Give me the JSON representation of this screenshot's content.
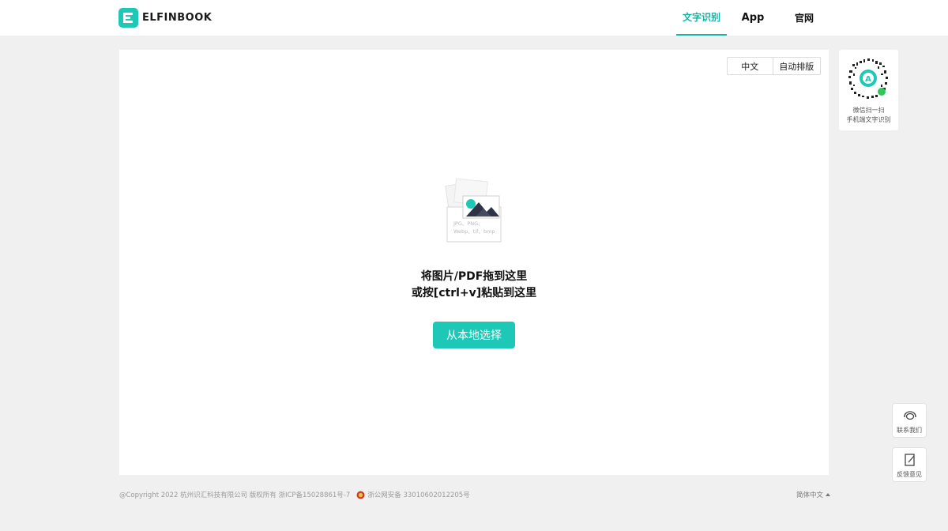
{
  "header": {
    "brand": "ELFINBOOK",
    "nav": {
      "ocr": "文字识别",
      "app": "App",
      "site": "官网"
    }
  },
  "toggle": {
    "chinese": "中文",
    "auto_layout": "自动排版"
  },
  "upload": {
    "formats_line1": "JPG、PNG、",
    "formats_line2": "Webp、tif、bmp",
    "prompt_line1": "将图片/PDF拖到这里",
    "prompt_line2": "或按[ctrl+v]粘贴到这里",
    "choose_button": "从本地选择"
  },
  "qr": {
    "line1": "微信扫一扫",
    "line2": "手机端文字识别"
  },
  "side": {
    "contact": "联系我们",
    "feedback": "反馈意见"
  },
  "footer": {
    "copyright": "@Copyright 2022 杭州识汇科技有限公司 版权所有 浙ICP备15028861号-7",
    "police": "浙公网安备 33010602012205号",
    "language": "简体中文"
  },
  "colors": {
    "accent": "#1ec8b6",
    "accent_text": "#13b5a6",
    "page_bg": "#f0f0f0"
  },
  "icons": [
    "logo-icon",
    "upload-illustration-icon",
    "qr-code-icon",
    "headset-icon",
    "edit-icon",
    "police-badge-icon",
    "caret-up-icon"
  ]
}
